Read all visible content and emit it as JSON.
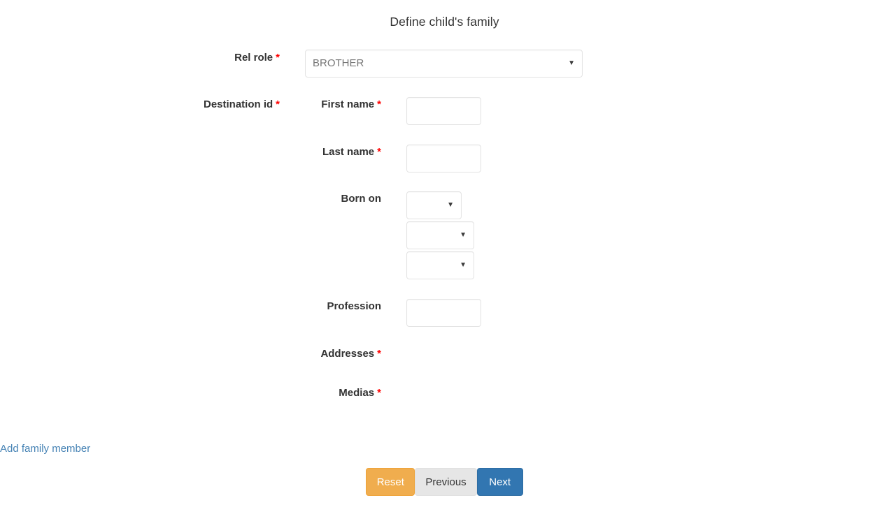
{
  "form": {
    "title": "Define child's family",
    "required_marker": "*",
    "dropdown_glyph": "▼"
  },
  "fields": {
    "rel_role": {
      "label": "Rel role",
      "required": true,
      "value": "BROTHER",
      "options": [
        "BROTHER"
      ]
    },
    "destination_id": {
      "label": "Destination id",
      "required": true
    },
    "first_name": {
      "label": "First name",
      "required": true,
      "value": "",
      "placeholder": ""
    },
    "last_name": {
      "label": "Last name",
      "required": true,
      "value": "",
      "placeholder": ""
    },
    "born_on": {
      "label": "Born on",
      "required": false,
      "day": {
        "value": "",
        "options": []
      },
      "month": {
        "value": "",
        "options": []
      },
      "year": {
        "value": "",
        "options": []
      }
    },
    "profession": {
      "label": "Profession",
      "required": false,
      "value": "",
      "placeholder": ""
    },
    "addresses": {
      "label": "Addresses",
      "required": true
    },
    "medias": {
      "label": "Medias",
      "required": true
    }
  },
  "actions": {
    "add_family_member": "Add family member",
    "reset": "Reset",
    "previous": "Previous",
    "next": "Next"
  },
  "colors": {
    "required_asterisk": "#ff0000",
    "link": "#4582b4",
    "reset_button": "#f0ad4e",
    "previous_button": "#e6e6e6",
    "next_button": "#3276b1",
    "text": "#333333",
    "border": "#e3e3e3"
  }
}
